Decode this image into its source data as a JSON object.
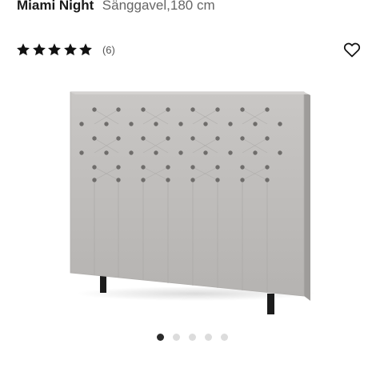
{
  "product": {
    "name": "Miami Night",
    "subtitle": "Sänggavel,180 cm"
  },
  "rating": {
    "stars": 5,
    "max_stars": 5,
    "review_count": "(6)",
    "star_icon": "star-icon",
    "star_color": "#111111"
  },
  "favorite": {
    "icon": "heart-outline-icon"
  },
  "gallery": {
    "image": "gray-tufted-fabric-headboard",
    "image_count": 5,
    "active_index": 0,
    "active_color": "#2b2b2b",
    "inactive_color": "#dcdcdc"
  }
}
